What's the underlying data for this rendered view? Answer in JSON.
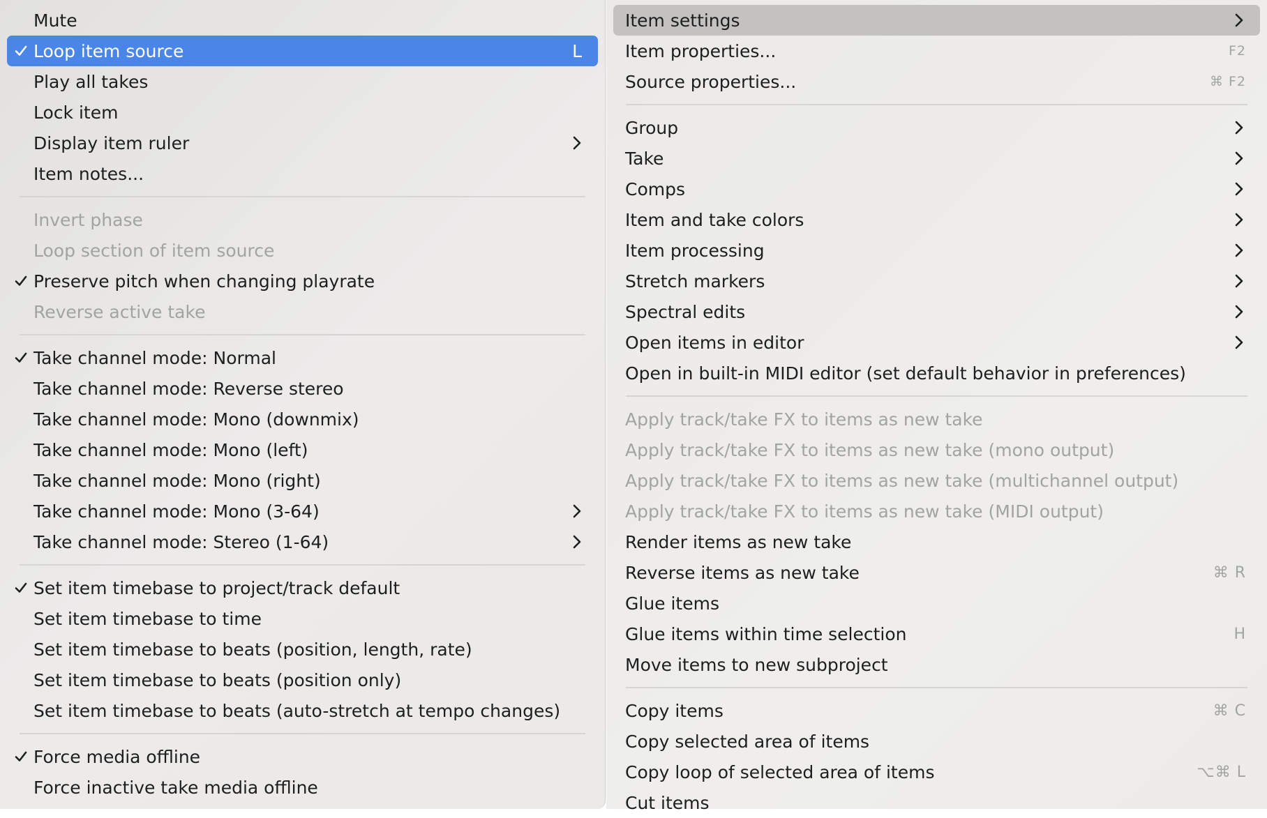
{
  "colors": {
    "highlight": "#4a86e8",
    "hover": "#c3c2c0",
    "text": "#1e1e1e",
    "disabled_text": "#a3a3a2"
  },
  "left_menu": {
    "items": [
      {
        "label": "Mute"
      },
      {
        "label": "Loop item source",
        "checked": true,
        "shortcut": "L",
        "highlighted": true
      },
      {
        "label": "Play all takes"
      },
      {
        "label": "Lock item"
      },
      {
        "label": "Display item ruler",
        "submenu": true
      },
      {
        "label": "Item notes..."
      },
      {
        "separator": true
      },
      {
        "label": "Invert phase",
        "disabled": true
      },
      {
        "label": "Loop section of item source",
        "disabled": true
      },
      {
        "label": "Preserve pitch when changing playrate",
        "checked": true
      },
      {
        "label": "Reverse active take",
        "disabled": true
      },
      {
        "separator": true
      },
      {
        "label": "Take channel mode: Normal",
        "checked": true
      },
      {
        "label": "Take channel mode: Reverse stereo"
      },
      {
        "label": "Take channel mode: Mono (downmix)"
      },
      {
        "label": "Take channel mode: Mono (left)"
      },
      {
        "label": "Take channel mode: Mono (right)"
      },
      {
        "label": "Take channel mode: Mono (3-64)",
        "submenu": true
      },
      {
        "label": "Take channel mode: Stereo (1-64)",
        "submenu": true
      },
      {
        "separator": true
      },
      {
        "label": "Set item timebase to project/track default",
        "checked": true
      },
      {
        "label": "Set item timebase to time"
      },
      {
        "label": "Set item timebase to beats (position, length, rate)"
      },
      {
        "label": "Set item timebase to beats (position only)"
      },
      {
        "label": "Set item timebase to beats (auto-stretch at tempo changes)"
      },
      {
        "separator": true
      },
      {
        "label": "Force media offline",
        "checked": true
      },
      {
        "label": "Force inactive take media offline"
      }
    ]
  },
  "right_menu": {
    "items": [
      {
        "label": "Item settings",
        "submenu": true,
        "hovered": true
      },
      {
        "label": "Item properties...",
        "shortcut": "F2",
        "small": true
      },
      {
        "label": "Source properties...",
        "shortcut": "⌘ F2",
        "small": true
      },
      {
        "separator": true
      },
      {
        "label": "Group",
        "submenu": true
      },
      {
        "label": "Take",
        "submenu": true
      },
      {
        "label": "Comps",
        "submenu": true
      },
      {
        "label": "Item and take colors",
        "submenu": true
      },
      {
        "label": "Item processing",
        "submenu": true
      },
      {
        "label": "Stretch markers",
        "submenu": true
      },
      {
        "label": "Spectral edits",
        "submenu": true
      },
      {
        "label": "Open items in editor",
        "submenu": true
      },
      {
        "label": "Open in built-in MIDI editor (set default behavior in preferences)"
      },
      {
        "separator": true
      },
      {
        "label": "Apply track/take FX to items as new take",
        "disabled": true
      },
      {
        "label": "Apply track/take FX to items as new take (mono output)",
        "disabled": true
      },
      {
        "label": "Apply track/take FX to items as new take (multichannel output)",
        "disabled": true
      },
      {
        "label": "Apply track/take FX to items as new take (MIDI output)",
        "disabled": true
      },
      {
        "label": "Render items as new take"
      },
      {
        "label": "Reverse items as new take",
        "shortcut": "⌘ R"
      },
      {
        "label": "Glue items"
      },
      {
        "label": "Glue items within time selection",
        "shortcut": "H"
      },
      {
        "label": "Move items to new subproject"
      },
      {
        "separator": true
      },
      {
        "label": "Copy items",
        "shortcut": "⌘ C"
      },
      {
        "label": "Copy selected area of items"
      },
      {
        "label": "Copy loop of selected area of items",
        "shortcut": "⌥⌘ L"
      },
      {
        "label": "Cut items"
      }
    ]
  }
}
